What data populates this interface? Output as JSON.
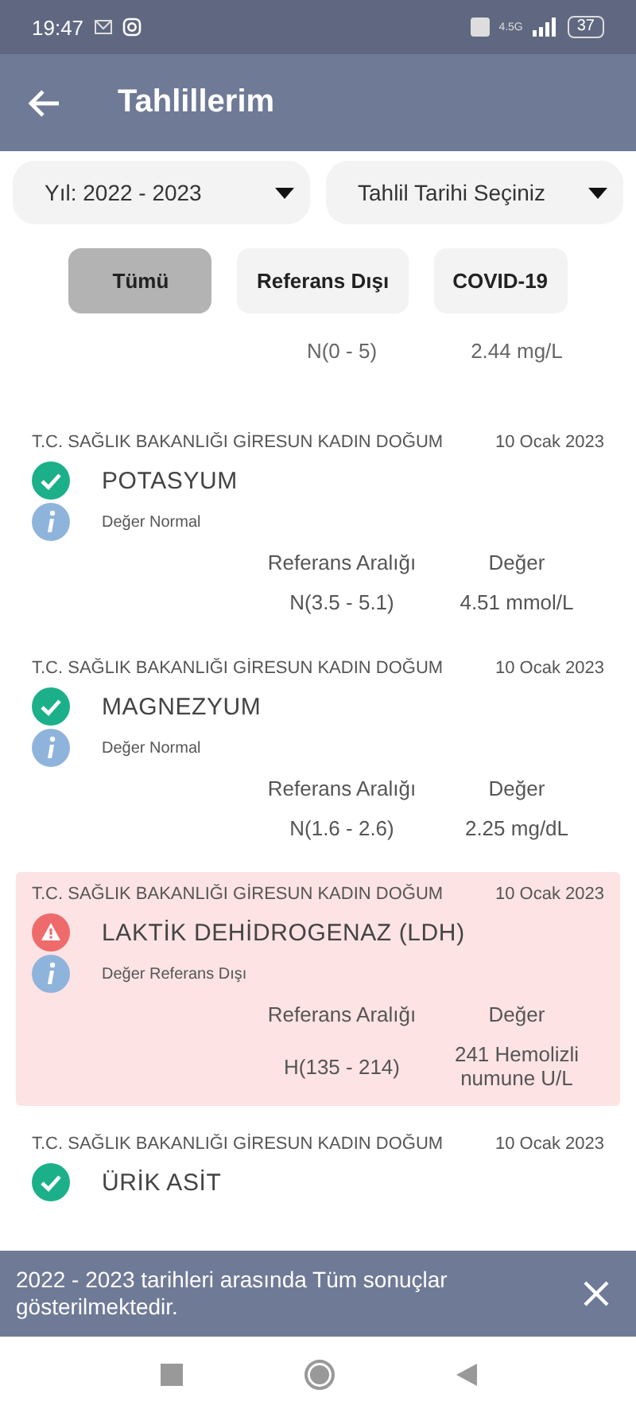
{
  "status_bar": {
    "time": "19:47",
    "battery": "37",
    "network": "4.5G"
  },
  "app_bar": {
    "title": "Tahlillerim"
  },
  "filters": [
    {
      "label": "Yıl: 2022 - 2023"
    },
    {
      "label": "Tahlil Tarihi Seçiniz"
    }
  ],
  "chips": [
    {
      "label": "Tümü",
      "selected": true
    },
    {
      "label": "Referans Dışı",
      "selected": false
    },
    {
      "label": "COVID-19",
      "selected": false
    }
  ],
  "partial_result": {
    "range": "N(0 - 5)",
    "value": "2.44 mg/L"
  },
  "results": [
    {
      "hospital": "T.C. SAĞLIK BAKANLIĞI GİRESUN KADIN DOĞUM",
      "date": "10 Ocak 2023",
      "name": "POTASYUM",
      "kind": "normal",
      "note": "Değer Normal",
      "range_label": "Referans Aralığı",
      "value_label": "Değer",
      "range": "N(3.5 - 5.1)",
      "value": "4.51 mmol/L"
    },
    {
      "hospital": "T.C. SAĞLIK BAKANLIĞI GİRESUN KADIN DOĞUM",
      "date": "10 Ocak 2023",
      "name": "MAGNEZYUM",
      "kind": "normal",
      "note": "Değer Normal",
      "range_label": "Referans Aralığı",
      "value_label": "Değer",
      "range": "N(1.6 - 2.6)",
      "value": "2.25 mg/dL"
    },
    {
      "hospital": "T.C. SAĞLIK BAKANLIĞI GİRESUN KADIN DOĞUM",
      "date": "10 Ocak 2023",
      "name": "LAKTİK DEHİDROGENAZ (LDH)",
      "kind": "abnormal",
      "note": "Değer Referans Dışı",
      "range_label": "Referans Aralığı",
      "value_label": "Değer",
      "range": "H(135 - 214)",
      "value": "241 Hemolizli numune U/L"
    },
    {
      "hospital": "T.C. SAĞLIK BAKANLIĞI GİRESUN KADIN DOĞUM",
      "date": "10 Ocak 2023",
      "name": "ÜRİK ASİT",
      "kind": "normal"
    }
  ],
  "snackbar": {
    "message": "2022 - 2023 tarihleri arasında Tüm sonuçlar gösterilmektedir."
  }
}
